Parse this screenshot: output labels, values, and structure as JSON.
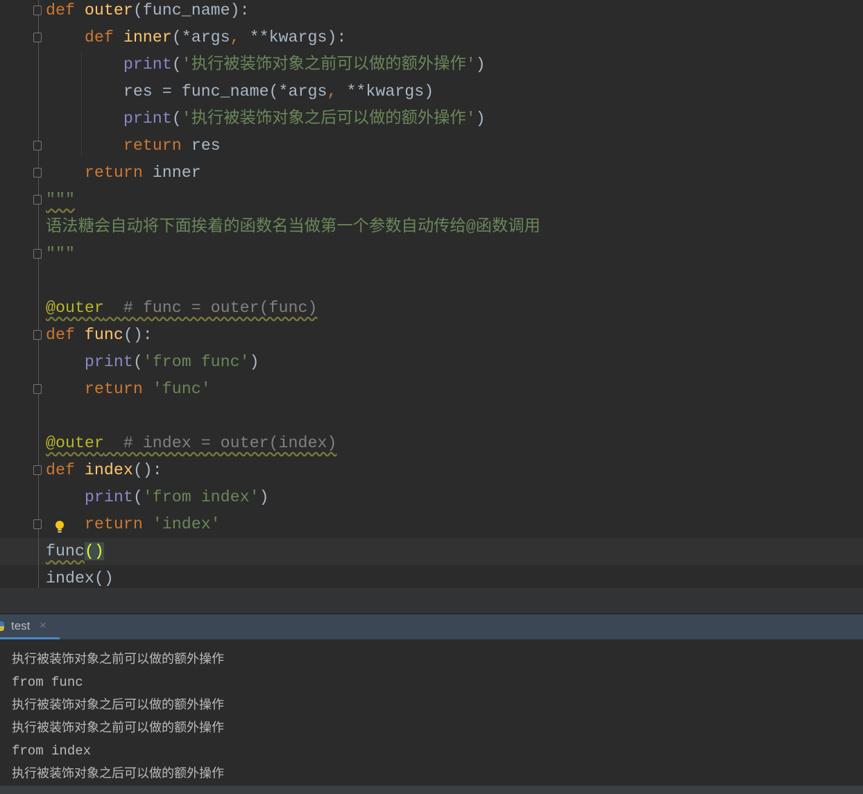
{
  "editor": {
    "lines": [
      [
        [
          "k",
          "def "
        ],
        [
          "f",
          "outer"
        ],
        [
          "t",
          "(func_name):"
        ]
      ],
      [
        [
          "t",
          "    "
        ],
        [
          "k",
          "def "
        ],
        [
          "f",
          "inner"
        ],
        [
          "t",
          "(*args"
        ],
        [
          "k",
          ", "
        ],
        [
          "t",
          "**kwargs):"
        ]
      ],
      [
        [
          "t",
          "        "
        ],
        [
          "b",
          "print"
        ],
        [
          "t",
          "("
        ],
        [
          "s",
          "'执行被装饰对象之前可以做的额外操作'"
        ],
        [
          "t",
          ")"
        ]
      ],
      [
        [
          "t",
          "        res = func_name(*args"
        ],
        [
          "k",
          ", "
        ],
        [
          "t",
          "**kwargs)"
        ]
      ],
      [
        [
          "t",
          "        "
        ],
        [
          "b",
          "print"
        ],
        [
          "t",
          "("
        ],
        [
          "s",
          "'执行被装饰对象之后可以做的额外操作'"
        ],
        [
          "t",
          ")"
        ]
      ],
      [
        [
          "t",
          "        "
        ],
        [
          "k",
          "return "
        ],
        [
          "t",
          "res"
        ]
      ],
      [
        [
          "t",
          "    "
        ],
        [
          "k",
          "return "
        ],
        [
          "t",
          "inner"
        ]
      ],
      [
        [
          "s",
          "\"\"\""
        ]
      ],
      [
        [
          "s",
          "语法糖会自动将下面挨着的函数名当做第一个参数自动传给@函数调用"
        ]
      ],
      [
        [
          "s",
          "\"\"\""
        ]
      ],
      [],
      [
        [
          "d",
          "@outer"
        ],
        [
          "c",
          "  # func = outer(func)"
        ]
      ],
      [
        [
          "k",
          "def "
        ],
        [
          "f",
          "func"
        ],
        [
          "t",
          "():"
        ]
      ],
      [
        [
          "t",
          "    "
        ],
        [
          "b",
          "print"
        ],
        [
          "t",
          "("
        ],
        [
          "s",
          "'from func'"
        ],
        [
          "t",
          ")"
        ]
      ],
      [
        [
          "t",
          "    "
        ],
        [
          "k",
          "return "
        ],
        [
          "s",
          "'func'"
        ]
      ],
      [],
      [
        [
          "d",
          "@outer"
        ],
        [
          "c",
          "  # index = outer(index)"
        ]
      ],
      [
        [
          "k",
          "def "
        ],
        [
          "f",
          "index"
        ],
        [
          "t",
          "():"
        ]
      ],
      [
        [
          "t",
          "    "
        ],
        [
          "b",
          "print"
        ],
        [
          "t",
          "("
        ],
        [
          "s",
          "'from index'"
        ],
        [
          "t",
          ")"
        ]
      ],
      [
        [
          "t",
          "    "
        ],
        [
          "k",
          "return "
        ],
        [
          "s",
          "'index'"
        ]
      ],
      [
        [
          "t",
          "func"
        ],
        [
          "hl",
          "()"
        ]
      ],
      [
        [
          "t",
          "index()"
        ]
      ]
    ]
  },
  "run_tab": {
    "label": "test",
    "close": "×"
  },
  "output": {
    "lines": [
      "执行被装饰对象之前可以做的额外操作",
      "from func",
      "执行被装饰对象之后可以做的额外操作",
      "执行被装饰对象之前可以做的额外操作",
      "from index",
      "执行被装饰对象之后可以做的额外操作"
    ]
  }
}
